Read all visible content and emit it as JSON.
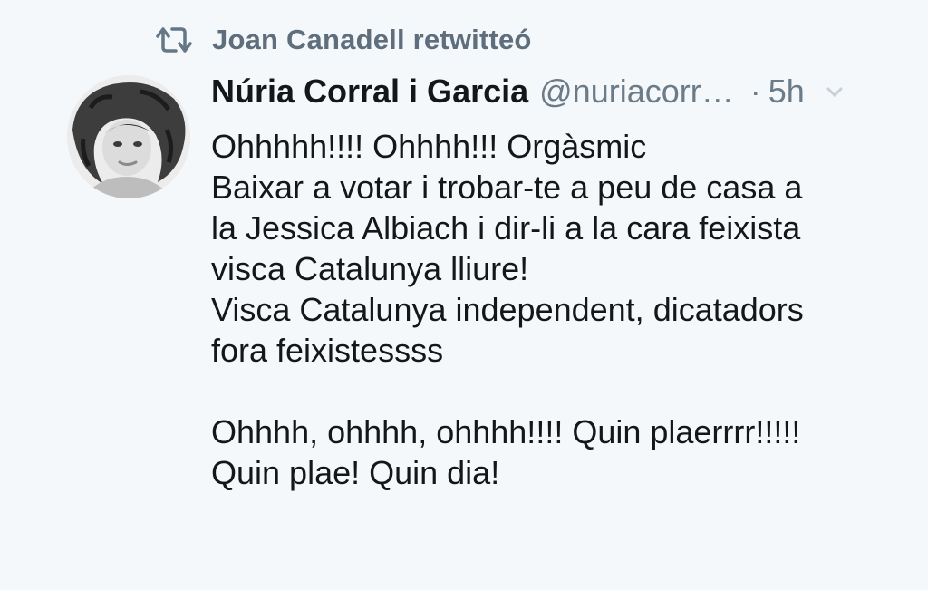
{
  "retweet": {
    "icon": "retweet-icon",
    "text": "Joan Canadell retwitteó"
  },
  "tweet": {
    "avatar_icon": "avatar-photo",
    "display_name": "Núria Corral i Garcia",
    "handle": "@nuriacorr…",
    "separator": "·",
    "time": "5h",
    "more_icon": "chevron-down-icon",
    "lines": [
      "Ohhhhh!!!! Ohhhh!!! Orgàsmic",
      "Baixar a votar i trobar-te a peu de casa a",
      "la Jessica Albiach i dir-li a la cara feixista",
      "visca Catalunya lliure!",
      "Visca Catalunya independent, dicatadors",
      "fora feixistessss",
      "",
      "Ohhhh, ohhhh, ohhhh!!!! Quin plaerrrr!!!!!",
      "Quin plae! Quin dia!"
    ]
  },
  "colors": {
    "background": "#f5f8fa",
    "text": "#14171a",
    "secondary": "#657786"
  }
}
